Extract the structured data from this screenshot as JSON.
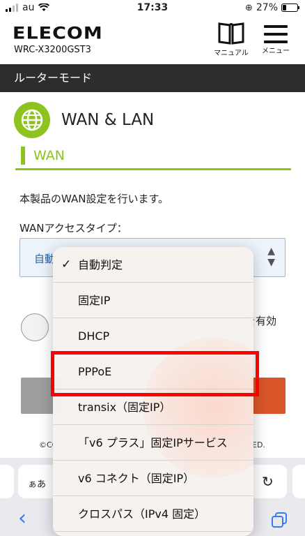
{
  "status_bar": {
    "carrier": "au",
    "time": "17:33",
    "battery": "27%",
    "battery_level": 0.27
  },
  "header": {
    "brand": "ELECOM",
    "model": "WRC-X3200GST3",
    "manual_label": "マニュアル",
    "menu_label": "メニュー"
  },
  "mode_bar": {
    "label": "ルーターモード"
  },
  "section": {
    "title": "WAN & LAN",
    "subtitle": "WAN"
  },
  "form": {
    "description": "本製品のWAN設定を行います。",
    "access_type_label": "WANアクセスタイプ：",
    "select_value_visible": "自動",
    "enable_text": "を有効"
  },
  "footer": {
    "copyright_left": "©CO",
    "copyright_right": "ED."
  },
  "dropdown": {
    "options": [
      {
        "label": "自動判定",
        "selected": true
      },
      {
        "label": "固定IP",
        "selected": false
      },
      {
        "label": "DHCP",
        "selected": false
      },
      {
        "label": "PPPoE",
        "selected": false
      },
      {
        "label": "transix（固定IP）",
        "selected": false
      },
      {
        "label": "「v6 プラス」固定IPサービス",
        "selected": false
      },
      {
        "label": "v6 コネクト（固定IP）",
        "selected": false
      },
      {
        "label": "クロスパス（IPv4 固定）",
        "selected": false
      }
    ],
    "check_mark": "✓",
    "highlighted_option": "PPPoE"
  },
  "browser_bar": {
    "text_size_label": "ぁあ",
    "reload_icon": "reload-icon",
    "back_icon": "back-chevron-icon",
    "tabs_icon": "tabs-icon"
  },
  "colors": {
    "accent_green": "#8dc21f",
    "mode_bar": "#2d2d2d",
    "highlight": "#ff0000",
    "link_blue": "#2f7cf6"
  }
}
